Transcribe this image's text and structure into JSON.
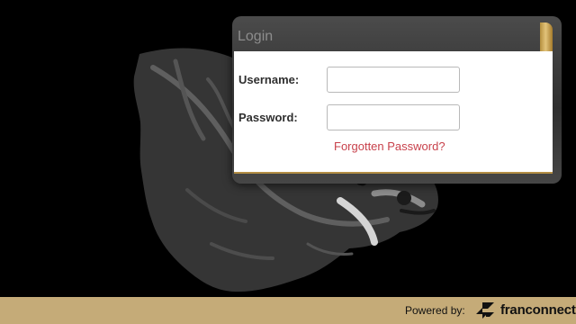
{
  "login": {
    "title": "Login",
    "username_label": "Username:",
    "username_value": "",
    "password_label": "Password:",
    "password_value": "",
    "forgot_link": "Forgotten Password?"
  },
  "footer": {
    "powered_by": "Powered by:",
    "brand": "franconnect",
    "brand_icon": "franconnect-logo-icon"
  },
  "background": {
    "mascot_icon": "boar-head-icon"
  },
  "colors": {
    "background": "#000000",
    "panel": "#ffffff",
    "gold_accent": "#b48e45",
    "footer": "#c5ab78",
    "link": "#c8414b"
  }
}
